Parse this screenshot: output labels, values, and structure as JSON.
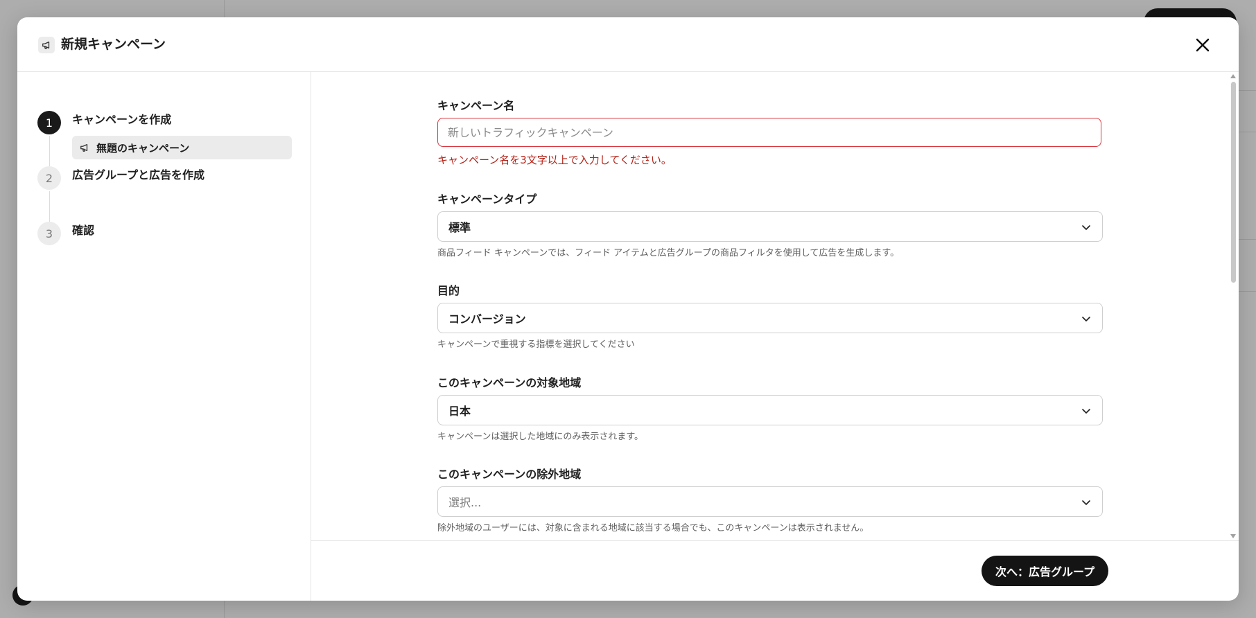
{
  "modal": {
    "title": "新規キャンペーン"
  },
  "stepper": {
    "steps": [
      {
        "number": "1",
        "label": "キャンペーンを作成"
      },
      {
        "number": "2",
        "label": "広告グループと広告を作成"
      },
      {
        "number": "3",
        "label": "確認"
      }
    ],
    "sub_item": "無題のキャンペーン"
  },
  "form": {
    "campaign_name": {
      "label": "キャンペーン名",
      "value": "",
      "placeholder": "新しいトラフィックキャンペーン",
      "error": "キャンペーン名を3文字以上で入力してください。"
    },
    "campaign_type": {
      "label": "キャンペーンタイプ",
      "value": "標準",
      "help": "商品フィード キャンペーンでは、フィード アイテムと広告グループの商品フィルタを使用して広告を生成します。"
    },
    "objective": {
      "label": "目的",
      "value": "コンバージョン",
      "help": "キャンペーンで重視する指標を選択してください"
    },
    "target_regions": {
      "label": "このキャンペーンの対象地域",
      "value": "日本",
      "help": "キャンペーンは選択した地域にのみ表示されます。"
    },
    "excluded_regions": {
      "label": "このキャンペーンの除外地域",
      "placeholder": "選択...",
      "help": "除外地域のユーザーには、対象に含まれる地域に該当する場合でも、このキャンペーンは表示されません。"
    }
  },
  "footer": {
    "next_label": "次へ：広告グループ"
  },
  "colors": {
    "primary": "#141414",
    "error": "#b42318",
    "error_border": "#d9363e"
  }
}
